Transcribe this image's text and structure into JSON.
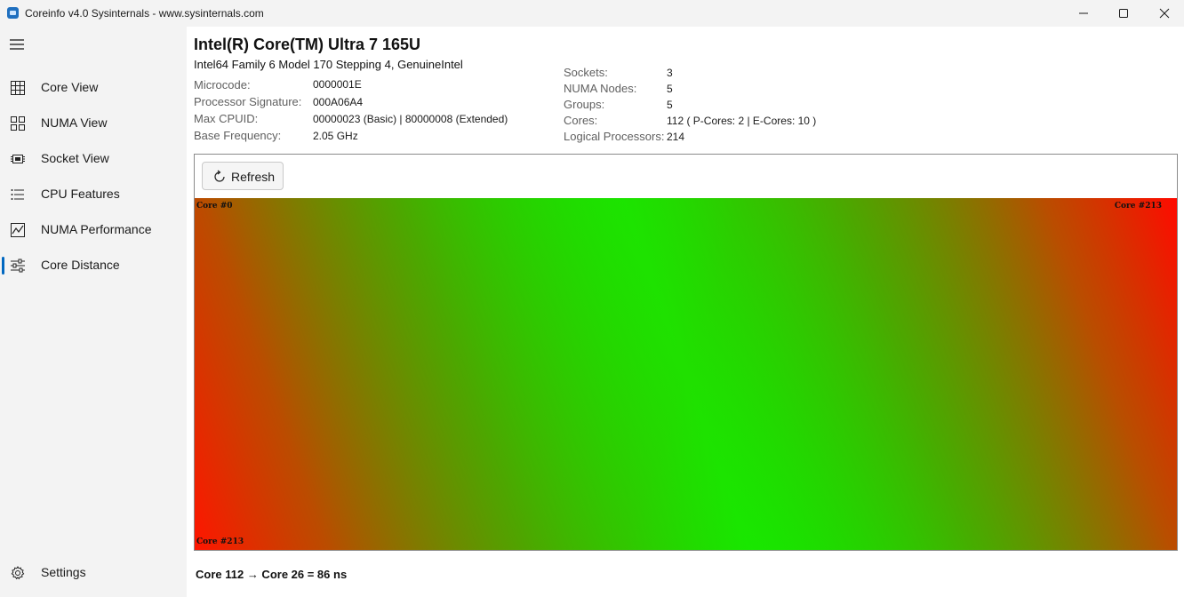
{
  "window": {
    "title": "Coreinfo v4.0  Sysinternals - www.sysinternals.com"
  },
  "sidebar": {
    "items": [
      {
        "label": "Core View",
        "icon": "grid-icon"
      },
      {
        "label": "NUMA View",
        "icon": "tiles-icon"
      },
      {
        "label": "Socket View",
        "icon": "chip-icon"
      },
      {
        "label": "CPU Features",
        "icon": "list-icon"
      },
      {
        "label": "NUMA Performance",
        "icon": "chart-icon"
      },
      {
        "label": "Core Distance",
        "icon": "sliders-icon",
        "active": true
      }
    ],
    "settings_label": "Settings"
  },
  "processor": {
    "name": "Intel(R) Core(TM) Ultra 7 165U",
    "family": "Intel64 Family 6 Model 170 Stepping 4, GenuineIntel",
    "microcode_label": "Microcode:",
    "microcode": "0000001E",
    "signature_label": "Processor Signature:",
    "signature": "000A06A4",
    "max_cpuid_label": "Max CPUID:",
    "max_cpuid": "00000023 (Basic) | 80000008 (Extended)",
    "base_freq_label": "Base Frequency:",
    "base_freq": "2.05 GHz"
  },
  "topology": {
    "sockets_label": "Sockets:",
    "sockets": "3",
    "numa_label": "NUMA Nodes:",
    "numa": "5",
    "groups_label": "Groups:",
    "groups": "5",
    "cores_label": "Cores:",
    "cores": "112  ( P-Cores: 2 | E-Cores: 10 )",
    "logical_label": "Logical Processors:",
    "logical": "214"
  },
  "panel": {
    "refresh_label": "Refresh",
    "top_left_label": "Core #0",
    "top_right_label": "Core #213",
    "bottom_left_label": "Core #213",
    "colors": {
      "near": "#00ff00",
      "far": "#ff0000"
    }
  },
  "readout": "Core 112 → Core 26 = 86 ns"
}
